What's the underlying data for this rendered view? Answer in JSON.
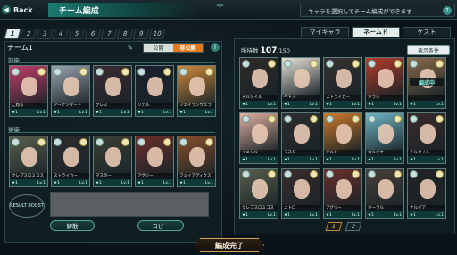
{
  "header": {
    "back_label": "Back",
    "title": "チーム編成",
    "help_text": "キャラを選択してチーム編成ができます",
    "help_icon": "?"
  },
  "team_tabs": [
    "1",
    "2",
    "3",
    "4",
    "5",
    "6",
    "7",
    "8",
    "9",
    "10"
  ],
  "team": {
    "name": "チーム1",
    "public_label": "公開",
    "private_label": "非公開",
    "info_icon": "i"
  },
  "front_label": "前衛",
  "back_label": "後衛",
  "front_cards": [
    {
      "name": "こねる",
      "level": "Lv.1",
      "color": "#c43d6a"
    },
    {
      "name": "アーテンダード",
      "level": "Lv.1",
      "color": "#9aa3b0"
    },
    {
      "name": "グレス",
      "level": "Lv.1",
      "color": "#3a2a30"
    },
    {
      "name": "リテル",
      "level": "Lv.1",
      "color": "#1c1f2d"
    },
    {
      "name": "フェイランヴェラ",
      "level": "Lv.1",
      "color": "#d08a3a"
    }
  ],
  "back_cards": [
    {
      "name": "クレプスロミコス",
      "level": "Lv.1",
      "color": "#59604e"
    },
    {
      "name": "ストライカー",
      "level": "Lv.1",
      "color": "#2c2c2c"
    },
    {
      "name": "マスター",
      "level": "Lv.1",
      "color": "#3b4034"
    },
    {
      "name": "アグリー",
      "level": "Lv.1",
      "color": "#6b2f2a"
    },
    {
      "name": "フェイアディクス",
      "level": "Lv.1",
      "color": "#8a4f2a"
    }
  ],
  "result_boost": "RESULT BOOST",
  "buttons": {
    "release": "解散",
    "copy": "コピー",
    "complete": "編成完了"
  },
  "right_tabs": [
    {
      "label": "マイキャラ",
      "active": false
    },
    {
      "label": "ネームド",
      "active": true
    },
    {
      "label": "ゲスト",
      "active": false
    }
  ],
  "owned": {
    "label": "所持数",
    "count": "107",
    "max": "/150"
  },
  "filter_label": "表示条件",
  "editing_label": "編成中",
  "grid": [
    {
      "name": "チルタイル",
      "level": "Lv.1",
      "color": "#2f2a28"
    },
    {
      "name": "ベトア",
      "level": "Lv.1",
      "color": "#e8e2da"
    },
    {
      "name": "ストライカー",
      "level": "Lv.1",
      "color": "#373230"
    },
    {
      "name": "ジラル",
      "level": "Lv.1",
      "color": "#b63b2a"
    },
    {
      "name": "",
      "level": "Lv.1",
      "color": "#8a6a4a"
    },
    {
      "name": "イェリル",
      "level": "Lv.1",
      "color": "#e0b0a0"
    },
    {
      "name": "マスター",
      "level": "Lv.1",
      "color": "#2e2e2e"
    },
    {
      "name": "ジルド",
      "level": "Lv.1",
      "color": "#d07a2a"
    },
    {
      "name": "カルジナ",
      "level": "Lv.1",
      "color": "#6fb7c7"
    },
    {
      "name": "チルタイル",
      "level": "Lv.1",
      "color": "#3a2a2a"
    },
    {
      "name": "クレプスロミコス",
      "level": "Lv.1",
      "color": "#59604e"
    },
    {
      "name": "ニトロ",
      "level": "Lv.1",
      "color": "#3a2b2a"
    },
    {
      "name": "アグリー",
      "level": "Lv.1",
      "color": "#6b2f2a"
    },
    {
      "name": "ジーラル",
      "level": "Lv.1",
      "color": "#4a4038"
    },
    {
      "name": "ナルボア",
      "level": "Lv.1",
      "color": "#222"
    }
  ],
  "pages": [
    "1",
    "2"
  ]
}
